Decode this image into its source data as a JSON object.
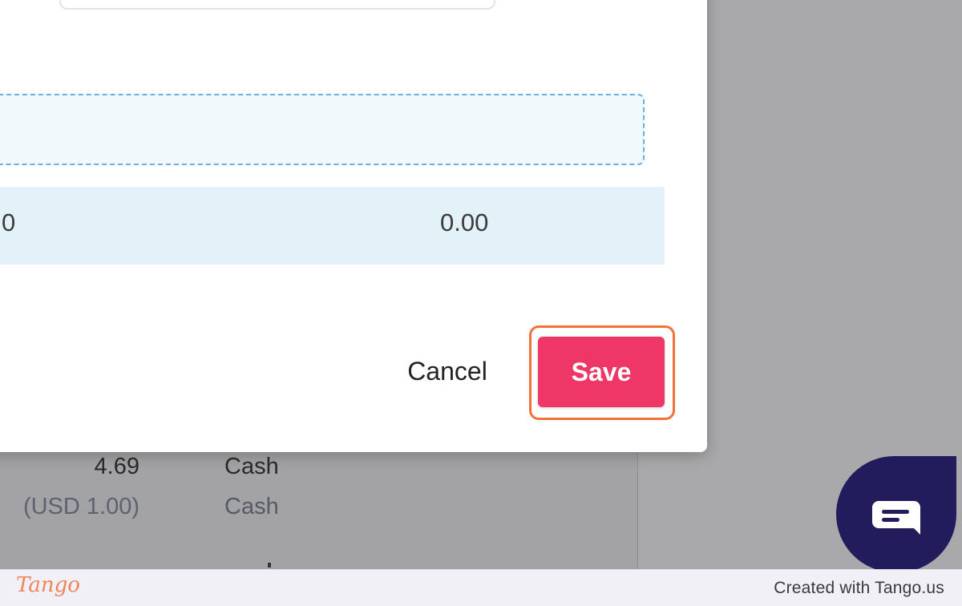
{
  "background": {
    "rows": [
      {
        "amount": "4.69",
        "method": "Cash"
      },
      {
        "amount": "(USD 1.00)",
        "method": "Cash"
      }
    ]
  },
  "dialog": {
    "row_values": [
      "0",
      "0.00"
    ],
    "cancel_label": "Cancel",
    "save_label": "Save"
  },
  "chat": {
    "icon": "chat-bubble-icon"
  },
  "footer": {
    "logo": "Tango",
    "credit": "Created with Tango.us"
  },
  "colors": {
    "save_button": "#ee3766",
    "highlight": "#f2733a",
    "chat_launcher": "#221c5d",
    "dropzone_border": "#6eaee0"
  }
}
